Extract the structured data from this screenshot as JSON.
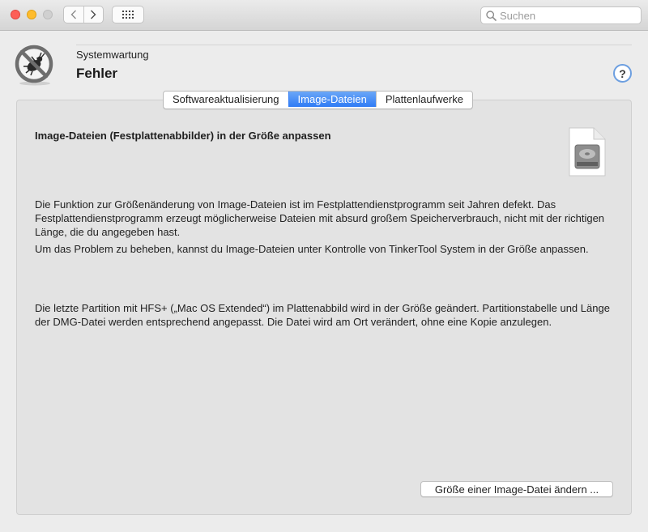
{
  "toolbar": {
    "search_placeholder": "Suchen"
  },
  "header": {
    "section": "Systemwartung",
    "title": "Fehler",
    "help": "?"
  },
  "tabs": [
    {
      "label": "Softwareaktualisierung",
      "active": false
    },
    {
      "label": "Image-Dateien",
      "active": true
    },
    {
      "label": "Plattenlaufwerke",
      "active": false
    }
  ],
  "content": {
    "heading": "Image-Dateien (Festplattenabbilder) in der Größe anpassen",
    "paragraph1": "Die Funktion zur Größenänderung von Image-Dateien ist im Festplattendienstprogramm seit Jahren defekt. Das Festplattendienstprogramm erzeugt möglicherweise Dateien mit absurd großem Speicherverbrauch, nicht mit der richtigen Länge, die du angegeben hast.",
    "paragraph2": "Um das Problem zu beheben, kannst du Image-Dateien unter Kontrolle von TinkerTool System in der Größe anpassen.",
    "paragraph3": "Die letzte Partition mit HFS+ („Mac OS Extended“) im Plattenabbild wird in der Größe geändert. Partitionstabelle und Länge der DMG-Datei werden entsprechend angepasst. Die Datei wird am Ort verändert, ohne eine Kopie anzulegen.",
    "action_button": "Größe einer Image-Datei ändern ..."
  },
  "icons": {
    "app": "bug-prohibited-icon",
    "document": "disk-image-document-icon",
    "back": "chevron-left-icon",
    "forward": "chevron-right-icon",
    "grid": "grid-icon",
    "search": "magnifier-icon"
  },
  "colors": {
    "accent": "#2f7bf5",
    "close": "#fd5f57",
    "minimize": "#febc2e"
  }
}
